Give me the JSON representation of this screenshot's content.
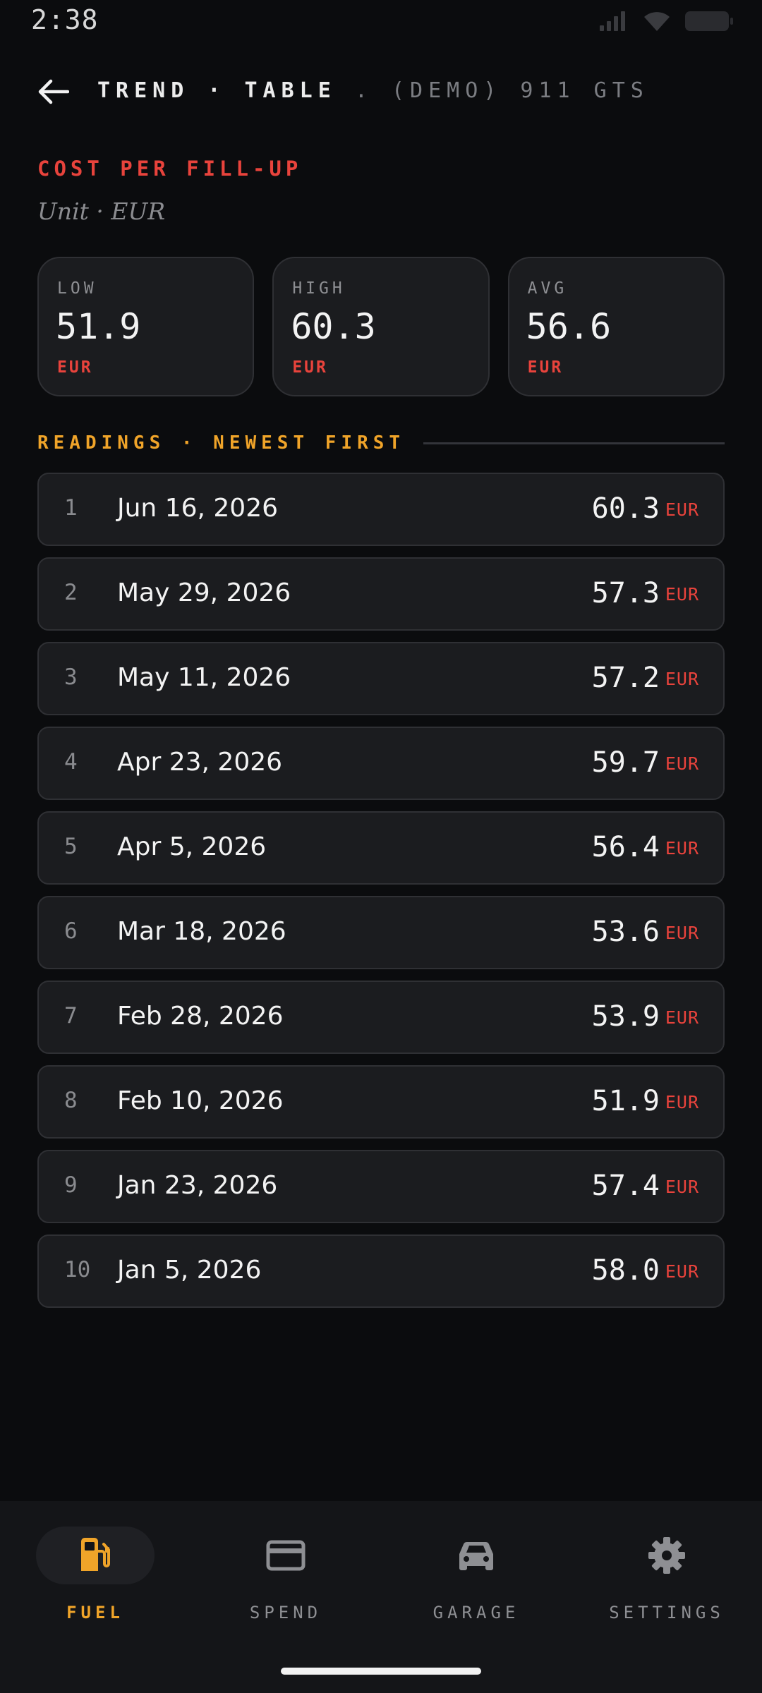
{
  "status_bar": {
    "time": "2:38",
    "icons": [
      "signal-icon",
      "wifi-icon",
      "battery-icon"
    ]
  },
  "header": {
    "back_icon": "arrow-left-icon",
    "title": "TREND · TABLE",
    "subtitle": ". (DEMO) 911 GTS"
  },
  "metric": {
    "title": "COST PER FILL-UP",
    "unit_label": "Unit · EUR"
  },
  "stats": [
    {
      "label": "LOW",
      "value": "51.9",
      "unit": "EUR"
    },
    {
      "label": "HIGH",
      "value": "60.3",
      "unit": "EUR"
    },
    {
      "label": "AVG",
      "value": "56.6",
      "unit": "EUR"
    }
  ],
  "readings": {
    "title": "READINGS · NEWEST FIRST",
    "rows": [
      {
        "index": "1",
        "date": "Jun 16, 2026",
        "value": "60.3",
        "unit": "EUR"
      },
      {
        "index": "2",
        "date": "May 29, 2026",
        "value": "57.3",
        "unit": "EUR"
      },
      {
        "index": "3",
        "date": "May 11, 2026",
        "value": "57.2",
        "unit": "EUR"
      },
      {
        "index": "4",
        "date": "Apr 23, 2026",
        "value": "59.7",
        "unit": "EUR"
      },
      {
        "index": "5",
        "date": "Apr 5, 2026",
        "value": "56.4",
        "unit": "EUR"
      },
      {
        "index": "6",
        "date": "Mar 18, 2026",
        "value": "53.6",
        "unit": "EUR"
      },
      {
        "index": "7",
        "date": "Feb 28, 2026",
        "value": "53.9",
        "unit": "EUR"
      },
      {
        "index": "8",
        "date": "Feb 10, 2026",
        "value": "51.9",
        "unit": "EUR"
      },
      {
        "index": "9",
        "date": "Jan 23, 2026",
        "value": "57.4",
        "unit": "EUR"
      },
      {
        "index": "10",
        "date": "Jan 5, 2026",
        "value": "58.0",
        "unit": "EUR"
      }
    ]
  },
  "nav": [
    {
      "label": "FUEL",
      "icon": "fuel-pump-icon",
      "active": true
    },
    {
      "label": "SPEND",
      "icon": "credit-card-icon",
      "active": false
    },
    {
      "label": "GARAGE",
      "icon": "car-icon",
      "active": false
    },
    {
      "label": "SETTINGS",
      "icon": "gear-icon",
      "active": false
    }
  ],
  "colors": {
    "background": "#0b0c0e",
    "card": "#1b1c1f",
    "accent_red": "#e8433c",
    "accent_amber": "#f0a429",
    "muted": "#8e8f93"
  }
}
